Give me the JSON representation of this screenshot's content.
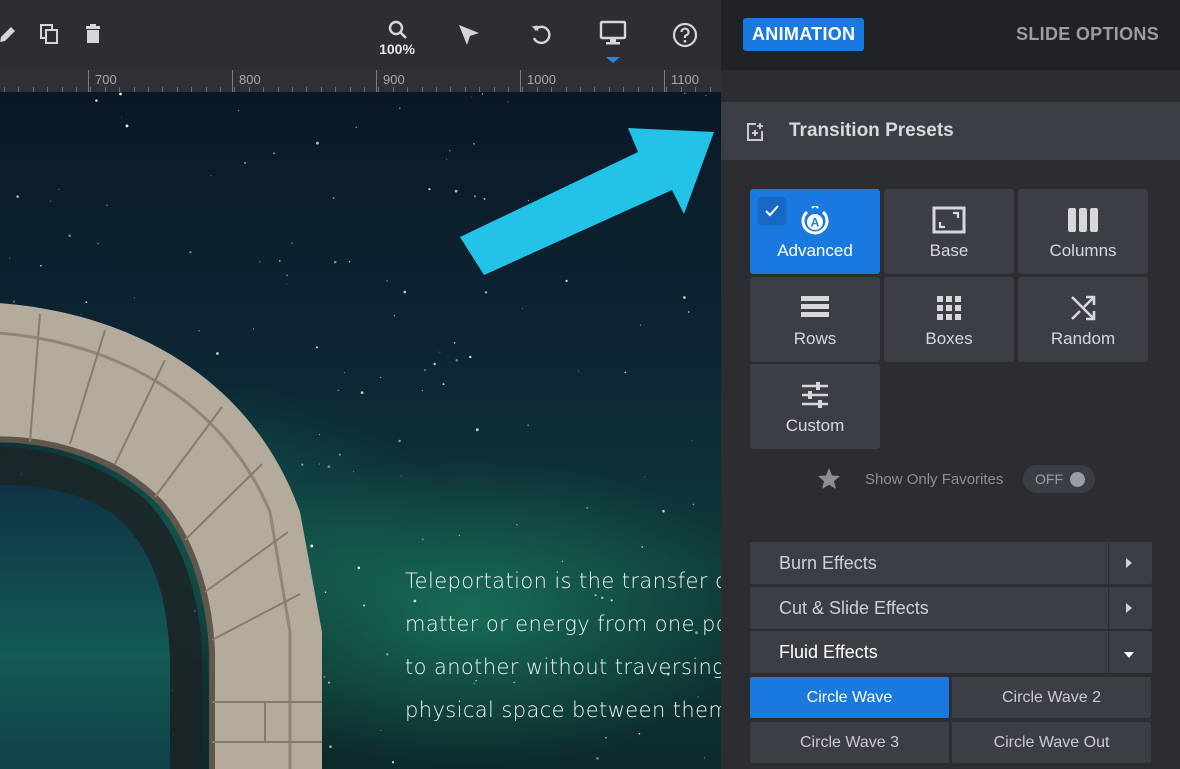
{
  "toolbar": {
    "zoom_label": "100%",
    "icons": [
      "edit-icon",
      "duplicate-icon",
      "delete-icon",
      "zoom-icon",
      "pointer-icon",
      "undo-icon",
      "desktop-icon",
      "help-icon"
    ]
  },
  "ruler": {
    "labels": [
      "700",
      "800",
      "900",
      "1000",
      "1100"
    ]
  },
  "slide": {
    "text_lines": [
      "Teleportation is the transfer of",
      "matter or energy from one point",
      "to another without traversing the",
      "physical space between them."
    ]
  },
  "panel": {
    "tab_animation": "ANIMATION",
    "tab_slide_options": "SLIDE OPTIONS",
    "section_title": "Transition Presets",
    "presets": [
      {
        "label": "Advanced",
        "icon": "advanced-icon",
        "active": true
      },
      {
        "label": "Base",
        "icon": "base-icon",
        "active": false
      },
      {
        "label": "Columns",
        "icon": "columns-icon",
        "active": false
      },
      {
        "label": "Rows",
        "icon": "rows-icon",
        "active": false
      },
      {
        "label": "Boxes",
        "icon": "boxes-icon",
        "active": false
      },
      {
        "label": "Random",
        "icon": "random-icon",
        "active": false
      },
      {
        "label": "Custom",
        "icon": "custom-icon",
        "active": false
      }
    ],
    "favorites_label": "Show Only Favorites",
    "favorites_toggle": "OFF",
    "categories": [
      {
        "label": "Burn Effects",
        "expanded": false
      },
      {
        "label": "Cut & Slide Effects",
        "expanded": false
      },
      {
        "label": "Fluid Effects",
        "expanded": true
      }
    ],
    "effects": [
      "Circle Wave",
      "Circle Wave 2",
      "Circle Wave 3",
      "Circle Wave Out"
    ],
    "selected_effect": "Circle Wave"
  },
  "colors": {
    "accent": "#1a79df",
    "highlight_arrow": "#22c3e6"
  }
}
